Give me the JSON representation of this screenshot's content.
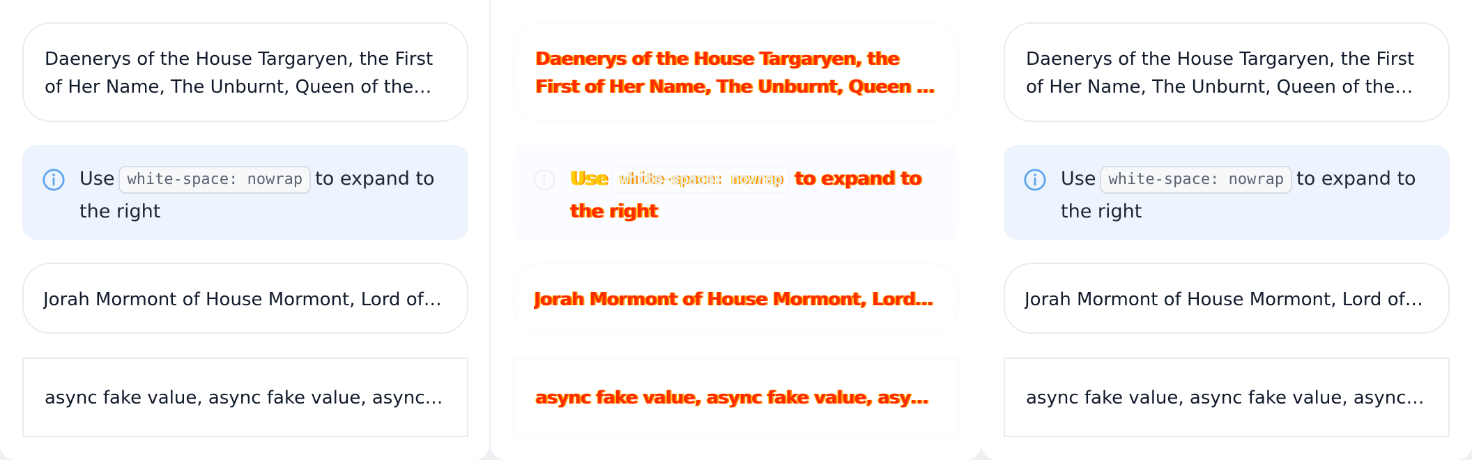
{
  "left": {
    "daenerys": "Daenerys of the House Targaryen, the First of Her Name, The Unburnt, Queen of the Andals and the First Men, Khaleesi of the Great Grass Sea, Breaker of Chains, and Mother of Dragons",
    "hint": {
      "icon": "info-icon",
      "prefix": "Use",
      "code": "white-space: nowrap",
      "suffix": "to expand to the right"
    },
    "jorah": "Jorah Mormont of House Mormont, Lord of Bear Island",
    "async": "async fake value, async fake value, async fake value"
  },
  "middle": {
    "daenerys": "Daenerys of the House Targaryen, the First of Her Name, The Unburnt, Queen of the Andals...",
    "hint": {
      "icon": "info-icon",
      "prefix": "Use",
      "code": "white-space: nowrap",
      "suffix": "to expand to the right"
    },
    "jorah": "Jorah Mormont of House Mormont, Lord of B...",
    "async": "async fake value, async fake value, async fak..."
  },
  "right": {
    "daenerys": "Daenerys of the House Targaryen, the First of Her Name, The Unburnt, Queen of the Andals and the First Men, Khaleesi of the Great Grass Sea, Breaker of Chains, and Mother of Dragons",
    "hint": {
      "icon": "info-icon",
      "prefix": "Use",
      "code": "white-space: nowrap",
      "suffix": "to expand to the right"
    },
    "jorah": "Jorah Mormont of House Mormont, Lord of Bear Island",
    "async": "async fake value, async fake value, async fake value"
  },
  "colors": {
    "page_bg": "#eef0f3",
    "card_border": "#e8ebf0",
    "hint_bg": "#edf4fd",
    "info_blue": "#5fa6ee",
    "text": "#111a2b"
  }
}
